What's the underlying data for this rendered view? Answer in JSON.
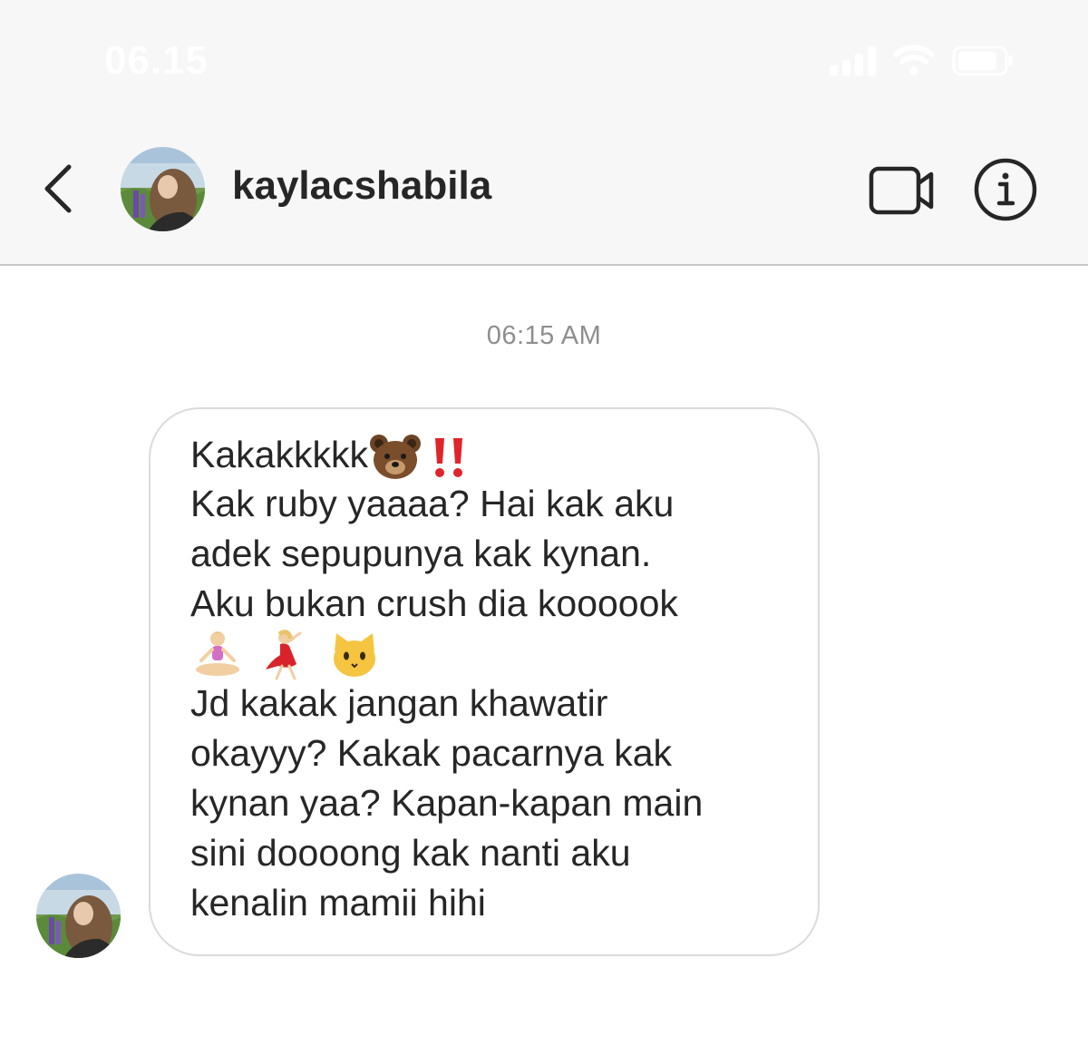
{
  "status_bar": {
    "time": "06.15"
  },
  "header": {
    "username": "kaylacshabila",
    "back_icon": "chevron-left-icon",
    "video_icon": "video-camera-icon",
    "info_icon": "info-icon"
  },
  "conversation": {
    "timestamp": "06:15 AM",
    "message": {
      "lines": [
        "Kakakkkkk",
        "Kak ruby yaaaa? Hai kak aku",
        "adek sepupunya kak kynan.",
        "Aku bukan crush dia koooook",
        "",
        "Jd kakak jangan khawatir",
        "okayyy? Kakak pacarnya kak",
        "kynan yaa? Kapan-kapan main",
        "sini doooong kak nanti aku",
        "kenalin mamii hihi"
      ],
      "emojis": [
        "bear-face",
        "double-exclamation",
        "person-in-lotus-position",
        "woman-dancing",
        "cat-face"
      ]
    }
  },
  "colors": {
    "header_bg": "#f7f7f7",
    "text": "#262626",
    "muted": "#8e8e8e",
    "bubble_border": "#dbdbdb",
    "exclamation": "#e0242b"
  }
}
